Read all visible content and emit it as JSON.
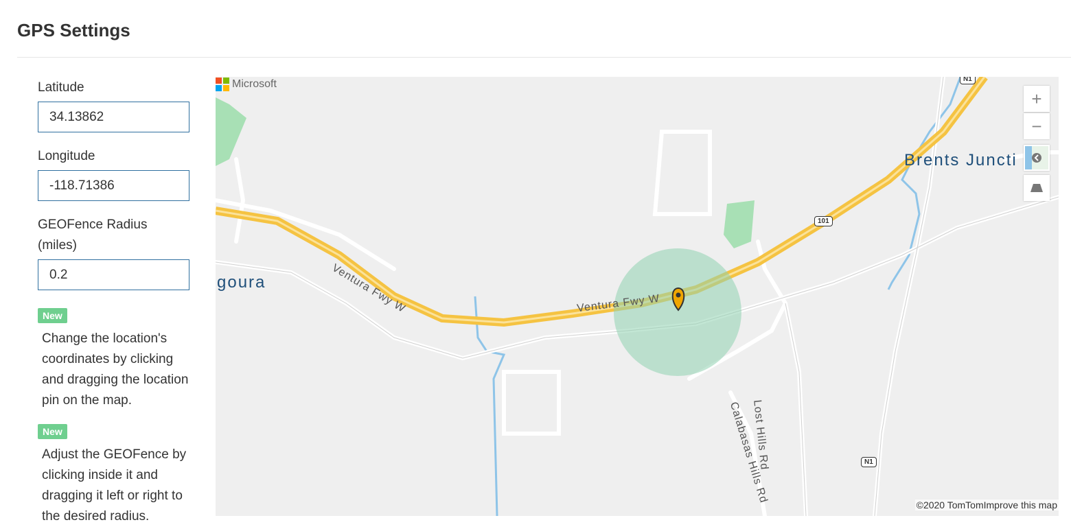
{
  "page": {
    "title": "GPS Settings"
  },
  "form": {
    "latitude": {
      "label": "Latitude",
      "value": "34.13862"
    },
    "longitude": {
      "label": "Longitude",
      "value": "-118.71386"
    },
    "radius": {
      "label": "GEOFence Radius (miles)",
      "value": "0.2"
    }
  },
  "tips": [
    {
      "badge": "New",
      "text": "Change the location's coordinates by clicking and dragging the location pin on the map."
    },
    {
      "badge": "New",
      "text": "Adjust the GEOFence by clicking inside it and dragging it left or right to the desired radius."
    }
  ],
  "map": {
    "provider_logo": "Microsoft",
    "places": [
      "Brents Juncti",
      "goura"
    ],
    "roads": [
      "Ventura Fwy W",
      "Ventura Fwy W",
      "Lost Hills Rd",
      "Calabasas Hills Rd"
    ],
    "shields": [
      "N1",
      "101",
      "N1"
    ],
    "controls": {
      "zoom_in": "+",
      "zoom_out": "−"
    },
    "attribution": {
      "copyright": "©2020 TomTom",
      "improve_link": "Improve this map"
    },
    "colors": {
      "freeway": "#f5c342",
      "geofence": "#8fd1b0",
      "pin": "#f0a500",
      "park": "#a8e0b5",
      "water": "#8ec4e8"
    }
  }
}
